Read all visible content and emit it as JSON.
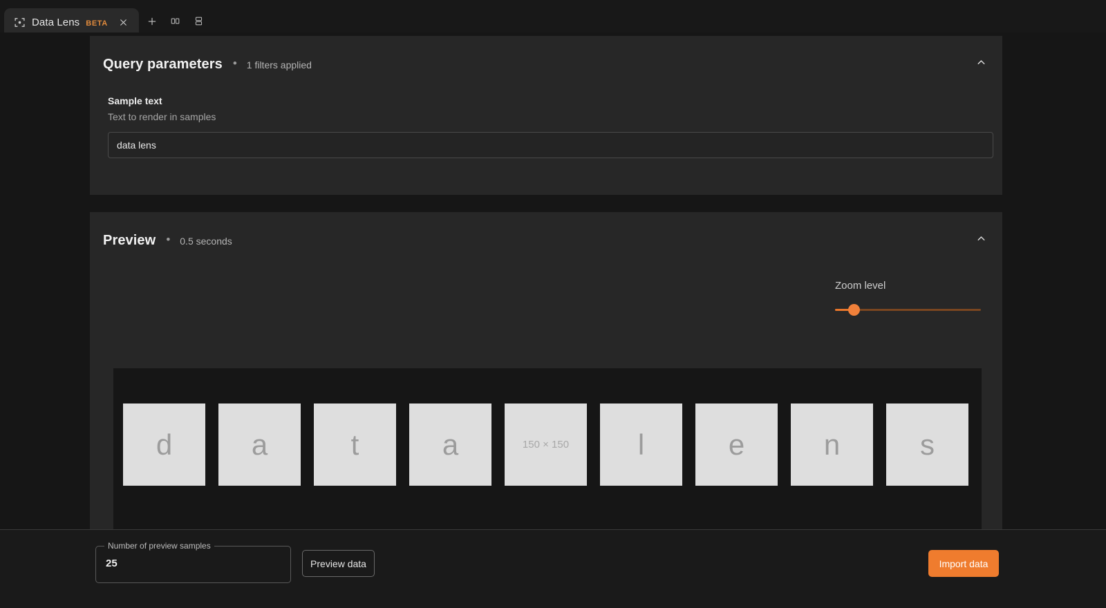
{
  "titlebar": {
    "tab": {
      "icon": "scan-frame-icon",
      "title": "Data Lens",
      "badge": "BETA",
      "close_icon": "close-icon"
    },
    "buttons": [
      {
        "name": "new-tab-button",
        "icon": "plus-icon",
        "label": "+"
      },
      {
        "name": "split-vertical-button",
        "icon": "split-vertical-icon",
        "label": ""
      },
      {
        "name": "split-horizontal-button",
        "icon": "split-horizontal-icon",
        "label": ""
      }
    ]
  },
  "query_card": {
    "title": "Query parameters",
    "separator": "•",
    "subtitle": "1 filters applied",
    "collapse_icon": "chevron-up-icon",
    "field": {
      "label": "Sample text",
      "help": "Text to render in samples",
      "value": "data lens",
      "placeholder": "data lens"
    }
  },
  "preview_card": {
    "title": "Preview",
    "separator": "•",
    "subtitle": "0.5 seconds",
    "collapse_icon": "chevron-up-icon",
    "zoom": {
      "label": "Zoom level",
      "value": 10,
      "min": 0,
      "max": 100
    },
    "samples": [
      {
        "kind": "glyph",
        "label": "d"
      },
      {
        "kind": "glyph",
        "label": "a"
      },
      {
        "kind": "glyph",
        "label": "t"
      },
      {
        "kind": "glyph",
        "label": "a"
      },
      {
        "kind": "broken",
        "label": "150 × 150"
      },
      {
        "kind": "glyph",
        "label": "l"
      },
      {
        "kind": "glyph",
        "label": "e"
      },
      {
        "kind": "glyph",
        "label": "n"
      },
      {
        "kind": "glyph",
        "label": "s"
      }
    ]
  },
  "bottombar": {
    "samples_field": {
      "label": "Number of preview samples",
      "value": "25"
    },
    "preview_button": "Preview data",
    "import_button": "Import data"
  },
  "colors": {
    "accent": "#ef7c2e",
    "beta": "#e08a3c",
    "card_bg": "#272727",
    "page_bg": "#161616",
    "tile_bg": "#dedede"
  }
}
